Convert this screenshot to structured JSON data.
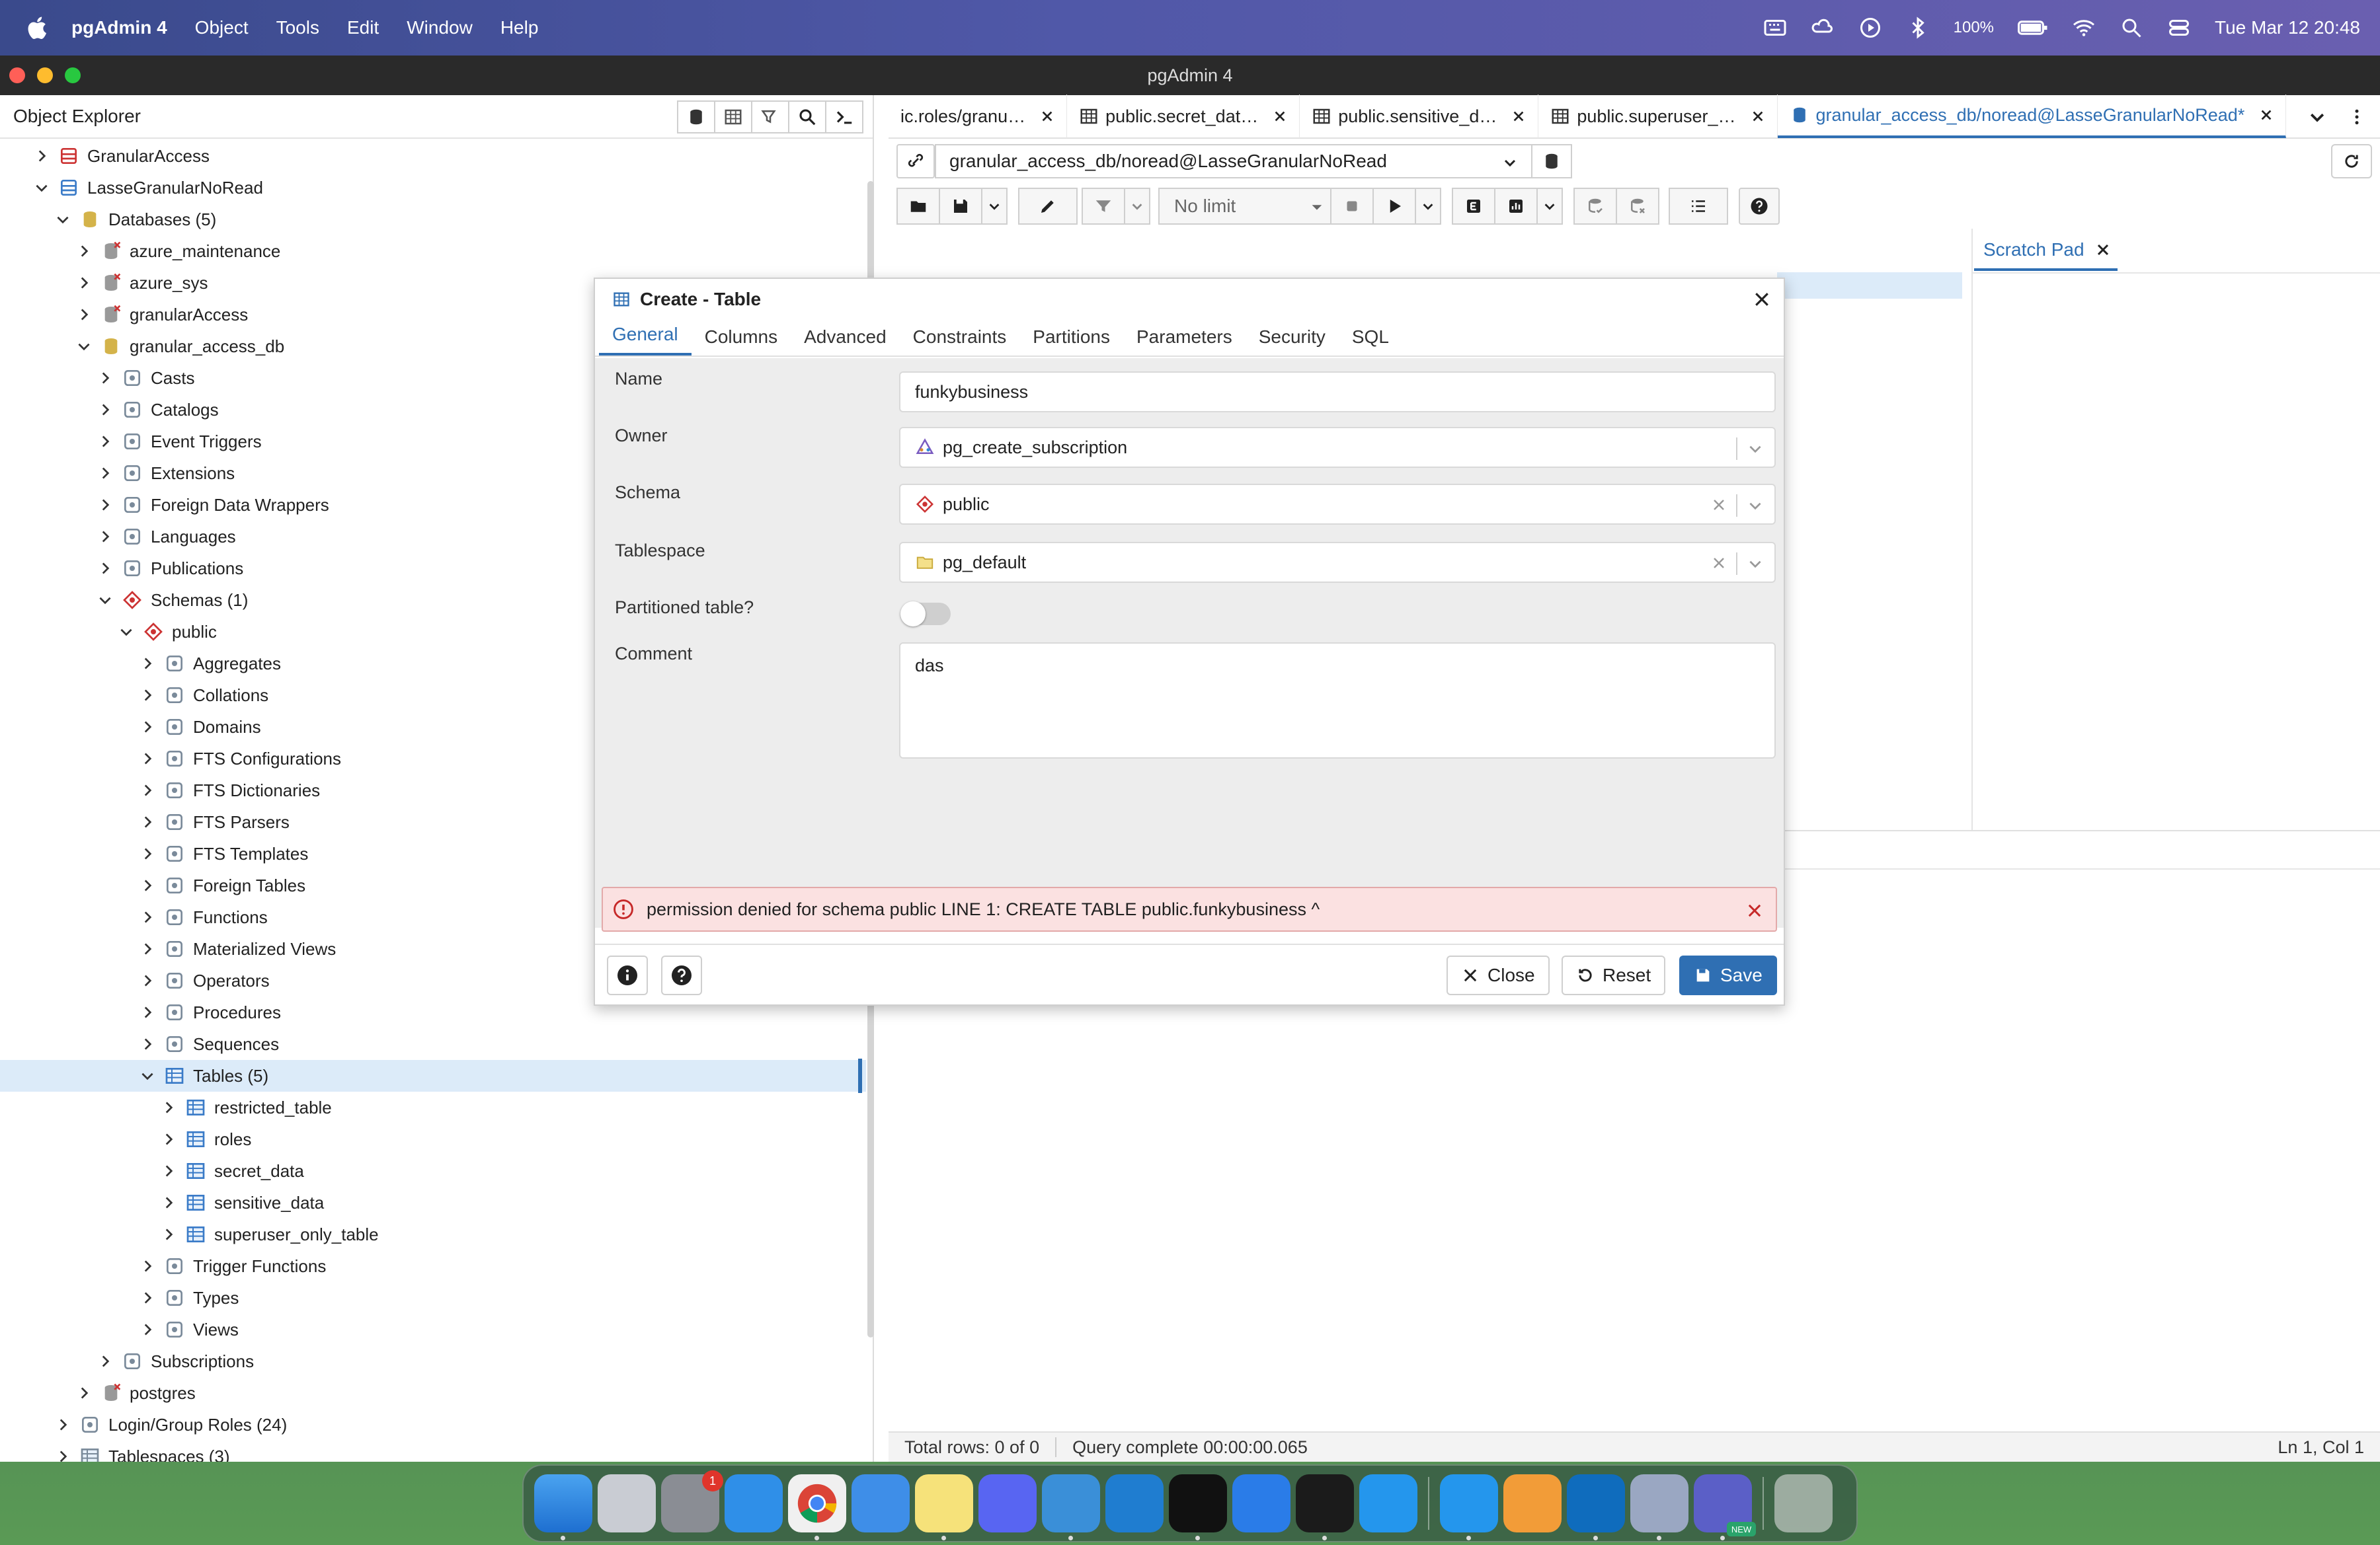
{
  "menubar": {
    "app_name": "pgAdmin 4",
    "menus": [
      "Object",
      "Tools",
      "Edit",
      "Window",
      "Help"
    ],
    "battery": "100%",
    "datetime": "Tue Mar 12  20:48"
  },
  "window": {
    "title": "pgAdmin 4"
  },
  "explorer": {
    "title": "Object Explorer",
    "tree": [
      {
        "label": "GranularAccess",
        "expanded": false,
        "icon": "server-disconnected-icon"
      },
      {
        "label": "LasseGranularNoRead",
        "expanded": true,
        "icon": "server-icon"
      },
      {
        "label": "Databases (5)",
        "expanded": true,
        "icon": "databases-icon"
      },
      {
        "label": "azure_maintenance",
        "expanded": false,
        "icon": "database-disconnected-icon"
      },
      {
        "label": "azure_sys",
        "expanded": false,
        "icon": "database-disconnected-icon"
      },
      {
        "label": "granularAccess",
        "expanded": false,
        "icon": "database-disconnected-icon"
      },
      {
        "label": "granular_access_db",
        "expanded": true,
        "icon": "database-icon"
      },
      {
        "label": "Casts",
        "expanded": false,
        "icon": "casts-icon"
      },
      {
        "label": "Catalogs",
        "expanded": false,
        "icon": "catalogs-icon"
      },
      {
        "label": "Event Triggers",
        "expanded": false,
        "icon": "event-triggers-icon"
      },
      {
        "label": "Extensions",
        "expanded": false,
        "icon": "extensions-icon"
      },
      {
        "label": "Foreign Data Wrappers",
        "expanded": false,
        "icon": "fdw-icon"
      },
      {
        "label": "Languages",
        "expanded": false,
        "icon": "languages-icon"
      },
      {
        "label": "Publications",
        "expanded": false,
        "icon": "publications-icon"
      },
      {
        "label": "Schemas (1)",
        "expanded": true,
        "icon": "schemas-icon"
      },
      {
        "label": "public",
        "expanded": true,
        "icon": "schema-icon"
      },
      {
        "label": "Aggregates",
        "expanded": false,
        "icon": "aggregates-icon"
      },
      {
        "label": "Collations",
        "expanded": false,
        "icon": "collations-icon"
      },
      {
        "label": "Domains",
        "expanded": false,
        "icon": "domains-icon"
      },
      {
        "label": "FTS Configurations",
        "expanded": false,
        "icon": "fts-config-icon"
      },
      {
        "label": "FTS Dictionaries",
        "expanded": false,
        "icon": "fts-dict-icon"
      },
      {
        "label": "FTS Parsers",
        "expanded": false,
        "icon": "fts-parser-icon"
      },
      {
        "label": "FTS Templates",
        "expanded": false,
        "icon": "fts-template-icon"
      },
      {
        "label": "Foreign Tables",
        "expanded": false,
        "icon": "foreign-tables-icon"
      },
      {
        "label": "Functions",
        "expanded": false,
        "icon": "functions-icon"
      },
      {
        "label": "Materialized Views",
        "expanded": false,
        "icon": "mviews-icon"
      },
      {
        "label": "Operators",
        "expanded": false,
        "icon": "operators-icon"
      },
      {
        "label": "Procedures",
        "expanded": false,
        "icon": "procedures-icon"
      },
      {
        "label": "Sequences",
        "expanded": false,
        "icon": "sequences-icon"
      },
      {
        "label": "Tables (5)",
        "expanded": true,
        "icon": "tables-icon",
        "selected": true
      },
      {
        "label": "restricted_table",
        "expanded": false,
        "icon": "table-icon"
      },
      {
        "label": "roles",
        "expanded": false,
        "icon": "table-icon"
      },
      {
        "label": "secret_data",
        "expanded": false,
        "icon": "table-icon"
      },
      {
        "label": "sensitive_data",
        "expanded": false,
        "icon": "table-icon"
      },
      {
        "label": "superuser_only_table",
        "expanded": false,
        "icon": "table-icon"
      },
      {
        "label": "Trigger Functions",
        "expanded": false,
        "icon": "trigger-functions-icon"
      },
      {
        "label": "Types",
        "expanded": false,
        "icon": "types-icon"
      },
      {
        "label": "Views",
        "expanded": false,
        "icon": "views-icon"
      },
      {
        "label": "Subscriptions",
        "expanded": false,
        "icon": "subscriptions-icon"
      },
      {
        "label": "postgres",
        "expanded": false,
        "icon": "database-disconnected-icon"
      },
      {
        "label": "Login/Group Roles (24)",
        "expanded": false,
        "icon": "roles-icon"
      },
      {
        "label": "Tablespaces (3)",
        "expanded": false,
        "icon": "tablespaces-icon"
      }
    ]
  },
  "tabs": [
    {
      "label": "ic.roles/granu…",
      "icon": "none",
      "active": false
    },
    {
      "label": "public.secret_dat…",
      "icon": "table-icon",
      "active": false
    },
    {
      "label": "public.sensitive_d…",
      "icon": "table-icon",
      "active": false
    },
    {
      "label": "public.superuser_…",
      "icon": "table-icon",
      "active": false
    },
    {
      "label": "granular_access_db/noread@LasseGranularNoRead*",
      "icon": "query-tool-icon",
      "active": true
    }
  ],
  "query": {
    "connection": "granular_access_db/noread@LasseGranularNoRead",
    "limit": "No limit",
    "scratch_pad": "Scratch Pad"
  },
  "status": {
    "rows": "Total rows: 0 of 0",
    "query": "Query complete 00:00:00.065",
    "cursor": "Ln 1, Col 1"
  },
  "dialog": {
    "title": "Create - Table",
    "tabs": [
      "General",
      "Columns",
      "Advanced",
      "Constraints",
      "Partitions",
      "Parameters",
      "Security",
      "SQL"
    ],
    "active_tab": "General",
    "fields": {
      "name_label": "Name",
      "name_value": "funkybusiness",
      "owner_label": "Owner",
      "owner_value": "pg_create_subscription",
      "schema_label": "Schema",
      "schema_value": "public",
      "tablespace_label": "Tablespace",
      "tablespace_value": "pg_default",
      "partitioned_label": "Partitioned table?",
      "partitioned_value": false,
      "comment_label": "Comment",
      "comment_value": "das"
    },
    "error": "permission denied for schema public LINE 1: CREATE TABLE public.funkybusiness ^",
    "buttons": {
      "close": "Close",
      "reset": "Reset",
      "save": "Save"
    }
  },
  "dock": {
    "apps": [
      "Finder",
      "Launchpad",
      "System Settings",
      "Safari",
      "Chrome",
      "Mail",
      "Notes",
      "Discord",
      "Fork",
      "VS Code",
      "Rider",
      "Xcode",
      "Terminal",
      "Docker",
      "Docker Desktop",
      "Sublime",
      "Outlook",
      "pgAdmin",
      "Teams",
      "Trash"
    ],
    "settings_badge": "1",
    "teams_badge": "NEW"
  }
}
